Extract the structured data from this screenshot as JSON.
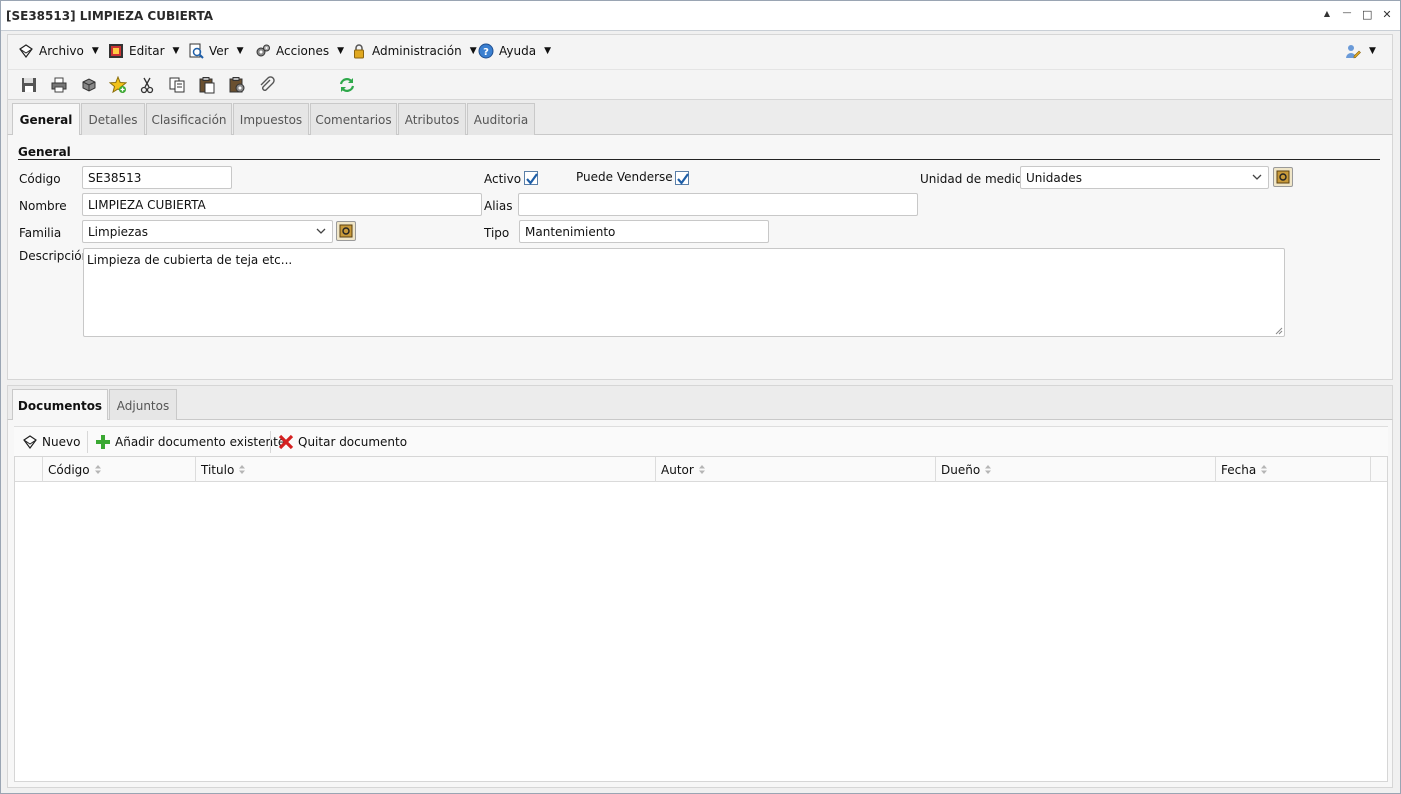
{
  "window": {
    "title": "[SE38513] LIMPIEZA CUBIERTA",
    "controls": {
      "collapse": "▲",
      "minimize": "—",
      "maximize": "□",
      "close": "✕"
    }
  },
  "menu": {
    "items": [
      {
        "label": "Archivo",
        "icon": "book-icon"
      },
      {
        "label": "Editar",
        "icon": "edit-icon"
      },
      {
        "label": "Ver",
        "icon": "view-icon"
      },
      {
        "label": "Acciones",
        "icon": "gears-icon"
      },
      {
        "label": "Administración",
        "icon": "lock-icon"
      },
      {
        "label": "Ayuda",
        "icon": "help-icon"
      }
    ],
    "user_icon": "user-edit-icon"
  },
  "toolbar": {
    "buttons": [
      "save-icon",
      "print-icon",
      "delete-icon",
      "favorite-icon",
      "cut-icon",
      "copy-icon",
      "paste-icon",
      "paste-special-icon",
      "attach-icon",
      "refresh-icon"
    ]
  },
  "tabs": {
    "main": [
      "General",
      "Detalles",
      "Clasificación",
      "Impuestos",
      "Comentarios",
      "Atributos",
      "Auditoria"
    ],
    "active": "General"
  },
  "general": {
    "section_title": "General",
    "codigo_label": "Código",
    "codigo_value": "SE38513",
    "nombre_label": "Nombre",
    "nombre_value": "LIMPIEZA CUBIERTA",
    "familia_label": "Familia",
    "familia_value": "Limpiezas",
    "descripcion_label": "Descripción",
    "descripcion_value": "Limpieza de cubierta de teja etc...",
    "activo_label": "Activo",
    "activo_checked": true,
    "vender_label": "Puede Venderse",
    "vender_checked": true,
    "alias_label": "Alias",
    "alias_value": "",
    "tipo_label": "Tipo",
    "tipo_value": "Mantenimiento",
    "unidad_label": "Unidad de medida",
    "unidad_value": "Unidades"
  },
  "lower_tabs": {
    "items": [
      "Documentos",
      "Adjuntos"
    ],
    "active": "Documentos"
  },
  "documents": {
    "toolbar": {
      "new_label": "Nuevo",
      "add_label": "Añadir documento existente",
      "remove_label": "Quitar documento"
    },
    "columns": [
      "Código",
      "Titulo",
      "Autor",
      "Dueño",
      "Fecha"
    ],
    "rows": []
  },
  "colors": {
    "accent_blue": "#1f5fa8",
    "add_green": "#3aa832",
    "remove_red": "#d42020",
    "refresh_green": "#2ea84a"
  }
}
